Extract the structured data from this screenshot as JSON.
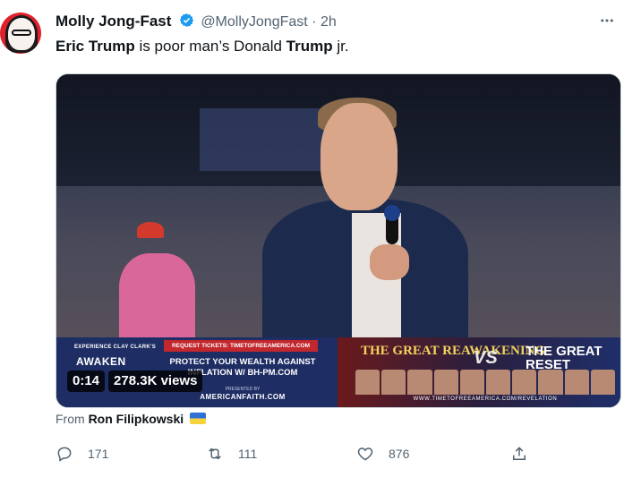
{
  "author": {
    "display_name": "Molly Jong-Fast",
    "handle": "@MollyJongFast",
    "separator": "·",
    "time": "2h"
  },
  "tweet": {
    "text_parts": [
      "Eric Trump",
      " is poor man’s Donald ",
      "Trump",
      " jr."
    ]
  },
  "video": {
    "duration": "0:14",
    "views": "278.3K views",
    "banner_left": {
      "small": "EXPERIENCE CLAY CLARK'S",
      "awaken": "AWAKEN",
      "tickets": "REQUEST TICKETS: TIMETOFREEAMERICA.COM",
      "protect": "PROTECT YOUR WEALTH AGAINST",
      "protect_line2": "INFLATION W/ BH-PM.COM",
      "presented": "PRESENTED BY",
      "site": "AMERICANFAITH.COM"
    },
    "banner_right": {
      "great_awakening": "THE GREAT REAWAKENING",
      "vs": "VS",
      "great_reset": "THE GREAT RESET",
      "url": "WWW.TIMETOFREEAMERICA.COM/REVELATION"
    }
  },
  "attribution": {
    "prefix": "From",
    "name": "Ron Filipkowski"
  },
  "actions": {
    "reply_count": "171",
    "retweet_count": "111",
    "like_count": "876"
  },
  "colors": {
    "verified": "#1d9bf0",
    "secondary_text": "#536471"
  }
}
